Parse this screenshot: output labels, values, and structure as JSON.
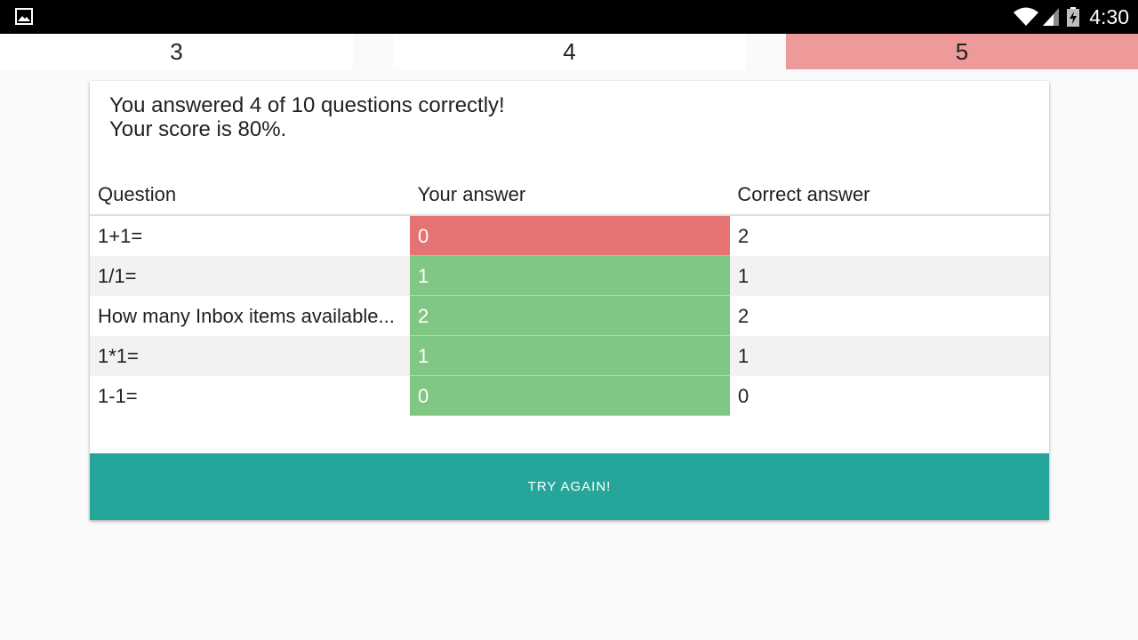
{
  "status_bar": {
    "time": "4:30",
    "icons": [
      "image-notification-icon",
      "wifi-icon",
      "cell-signal-icon",
      "battery-charging-icon"
    ]
  },
  "tabs": [
    {
      "label": "3",
      "state": "normal"
    },
    {
      "label": "4",
      "state": "current"
    },
    {
      "label": "5",
      "state": "incorrect",
      "color": "#ef9a9a"
    }
  ],
  "summary": {
    "line1": "You answered 4 of 10 questions correctly!",
    "line2": "Your score is 80%."
  },
  "table": {
    "headers": [
      "Question",
      "Your answer",
      "Correct answer"
    ],
    "rows": [
      {
        "question": "1+1=",
        "your_answer": "0",
        "correct_answer": "2",
        "result": "wrong"
      },
      {
        "question": "1/1=",
        "your_answer": "1",
        "correct_answer": "1",
        "result": "right"
      },
      {
        "question": "How many Inbox items available...",
        "your_answer": "2",
        "correct_answer": "2",
        "result": "right"
      },
      {
        "question": "1*1=",
        "your_answer": "1",
        "correct_answer": "1",
        "result": "right"
      },
      {
        "question": "1-1=",
        "your_answer": "0",
        "correct_answer": "0",
        "result": "right"
      }
    ]
  },
  "button": {
    "label": "TRY AGAIN!"
  },
  "colors": {
    "wrong": "#e57373",
    "right": "#81c784",
    "accent": "#26a69a",
    "tab_incorrect": "#ef9a9a"
  }
}
